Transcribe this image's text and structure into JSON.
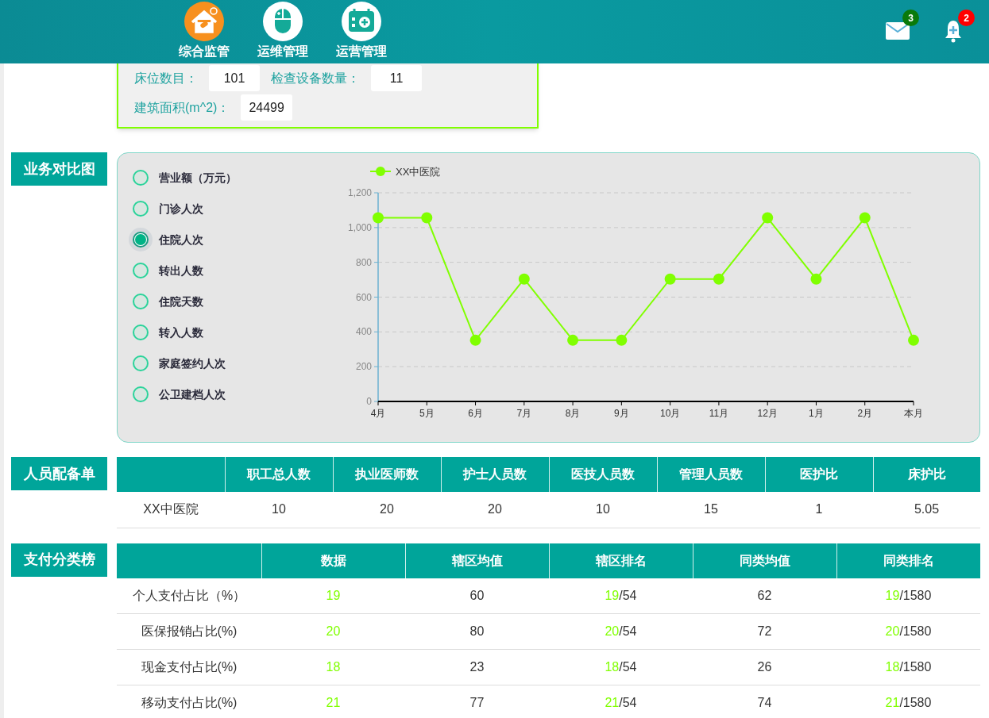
{
  "header": {
    "nav": [
      {
        "label": "综合监管",
        "kind": "house",
        "selected": true
      },
      {
        "label": "运维管理",
        "kind": "mouse",
        "selected": false
      },
      {
        "label": "运营管理",
        "kind": "calendar",
        "selected": false
      }
    ],
    "mail_count": "3",
    "alert_count": "2"
  },
  "info_card": {
    "rows": [
      [
        {
          "label": "床位数目：",
          "value": "101"
        },
        {
          "label": "检查设备数量：",
          "value": "11"
        }
      ],
      [
        {
          "label": "建筑面积(m^2)：",
          "value": "24499"
        }
      ]
    ]
  },
  "business_compare": {
    "title": "业务对比图",
    "options": [
      {
        "label": "营业额（万元）",
        "selected": false
      },
      {
        "label": "门诊人次",
        "selected": false
      },
      {
        "label": "住院人次",
        "selected": true
      },
      {
        "label": "转出人数",
        "selected": false
      },
      {
        "label": "住院天数",
        "selected": false
      },
      {
        "label": "转入人数",
        "selected": false
      },
      {
        "label": "家庭签约人次",
        "selected": false
      },
      {
        "label": "公卫建档人次",
        "selected": false
      }
    ],
    "chart_data": {
      "type": "line",
      "categories": [
        "4月",
        "5月",
        "6月",
        "7月",
        "8月",
        "9月",
        "10月",
        "11月",
        "12月",
        "1月",
        "2月",
        "本月"
      ],
      "grid": true,
      "series": [
        {
          "name": "XX中医院",
          "color": "#80ff00",
          "marker": "circle",
          "values": [
            1056,
            1056,
            352,
            704,
            352,
            352,
            704,
            704,
            1056,
            704,
            1056,
            352
          ]
        }
      ],
      "ylim": [
        0,
        1200
      ],
      "yticks": [
        {
          "value": 0,
          "label": "0"
        },
        {
          "value": 200,
          "label": "200"
        },
        {
          "value": 400,
          "label": "400"
        },
        {
          "value": 600,
          "label": "600"
        },
        {
          "value": 800,
          "label": "800"
        },
        {
          "value": 1000,
          "label": "1,000"
        },
        {
          "value": 1200,
          "label": "1,200"
        }
      ]
    }
  },
  "staff": {
    "title": "人员配备单",
    "columns": [
      "",
      "职工总人数",
      "执业医师数",
      "护士人员数",
      "医技人员数",
      "管理人员数",
      "医护比",
      "床护比"
    ],
    "rows": [
      [
        "XX中医院",
        "10",
        "20",
        "20",
        "10",
        "15",
        "1",
        "5.05"
      ]
    ]
  },
  "payment": {
    "title": "支付分类榜",
    "columns": [
      "",
      "数据",
      "辖区均值",
      "辖区排名",
      "同类均值",
      "同类排名"
    ],
    "rows": [
      {
        "label": "个人支付占比（%）",
        "value": "19",
        "district_avg": "60",
        "district_rank": "19",
        "district_total": "/54",
        "peer_avg": "62",
        "peer_rank": "19",
        "peer_total": "/1580"
      },
      {
        "label": "医保报销占比(%)",
        "value": "20",
        "district_avg": "80",
        "district_rank": "20",
        "district_total": "/54",
        "peer_avg": "72",
        "peer_rank": "20",
        "peer_total": "/1580"
      },
      {
        "label": "现金支付占比(%)",
        "value": "18",
        "district_avg": "23",
        "district_rank": "18",
        "district_total": "/54",
        "peer_avg": "26",
        "peer_rank": "18",
        "peer_total": "/1580"
      },
      {
        "label": "移动支付占比(%)",
        "value": "21",
        "district_avg": "77",
        "district_rank": "21",
        "district_total": "/54",
        "peer_avg": "74",
        "peer_rank": "21",
        "peer_total": "/1580"
      }
    ]
  }
}
